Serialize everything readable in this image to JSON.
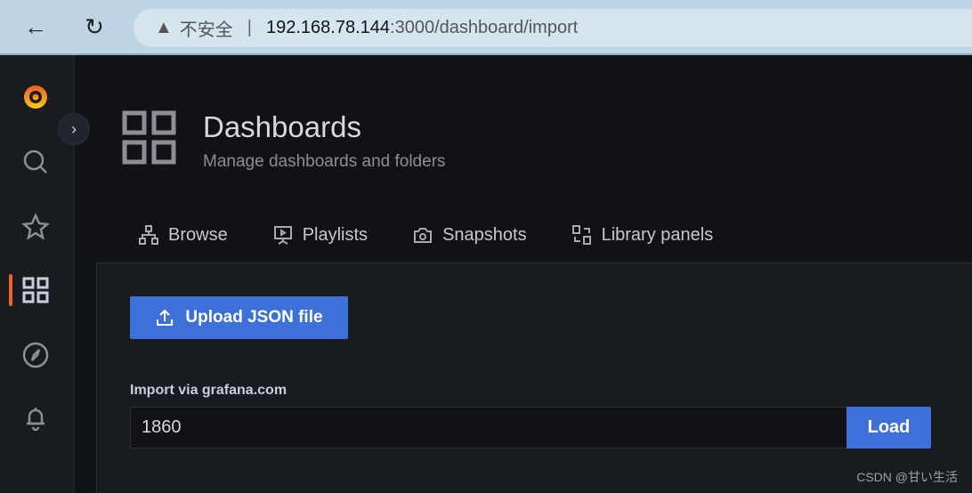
{
  "browser": {
    "security_label": "不安全",
    "url_host": "192.168.78.144",
    "url_rest": ":3000/dashboard/import"
  },
  "header": {
    "title": "Dashboards",
    "subtitle": "Manage dashboards and folders"
  },
  "tabs": [
    {
      "label": "Browse",
      "icon": "sitemap-icon"
    },
    {
      "label": "Playlists",
      "icon": "presentation-icon"
    },
    {
      "label": "Snapshots",
      "icon": "camera-icon"
    },
    {
      "label": "Library panels",
      "icon": "library-panel-icon"
    }
  ],
  "import": {
    "upload_label": "Upload JSON file",
    "via_label": "Import via grafana.com",
    "input_value": "1860",
    "load_label": "Load"
  },
  "watermark": "CSDN @甘い生活",
  "colors": {
    "accent": "#3d71d9",
    "active_indicator": "#f5622b"
  }
}
